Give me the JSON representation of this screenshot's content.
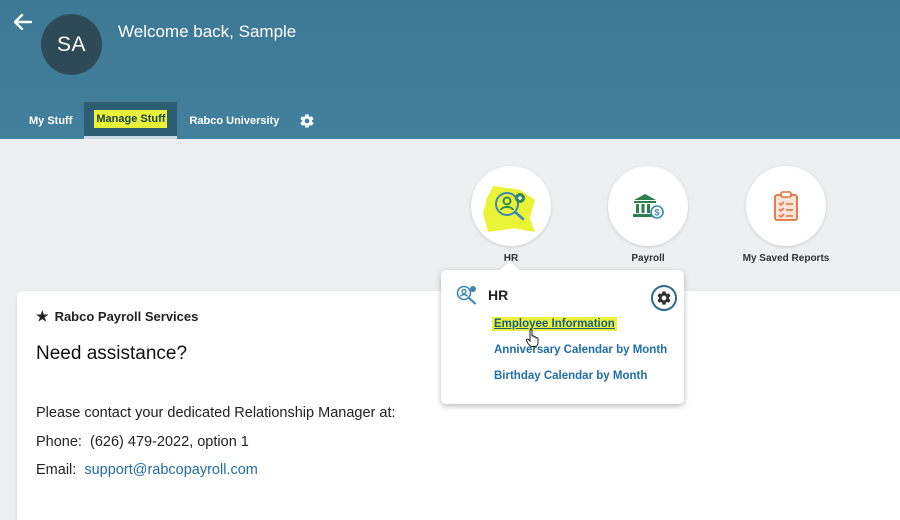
{
  "header": {
    "back_icon": "back-arrow-icon",
    "avatar_initials": "SA",
    "welcome_text": "Welcome back, Sample",
    "tabs": [
      {
        "label": "My Stuff"
      },
      {
        "label": "Manage Stuff",
        "active": true
      },
      {
        "label": "Rabco University"
      }
    ],
    "settings_icon": "gear-icon",
    "bg_color": "#3f7c98",
    "highlight_color": "#e8f43a"
  },
  "apps": [
    {
      "label": "HR",
      "icon": "hr-person-search-icon"
    },
    {
      "label": "Payroll",
      "icon": "bank-dollar-icon"
    },
    {
      "label": "My Saved Reports",
      "icon": "clipboard-checklist-icon"
    }
  ],
  "popup": {
    "title": "HR",
    "icon": "hr-person-search-icon",
    "settings_icon": "gear-icon",
    "links": [
      {
        "label": "Employee Information",
        "highlighted": true
      },
      {
        "label": "Anniversary Calendar by Month"
      },
      {
        "label": "Birthday Calendar by Month"
      }
    ]
  },
  "card": {
    "company": "Rabco Payroll Services",
    "title": "Need assistance?",
    "contact_line": "Please contact your dedicated Relationship Manager at:",
    "phone_label": "Phone:",
    "phone_value": "(626) 479-2022, option 1",
    "email_label": "Email:",
    "email_value": "support@rabcopayroll.com"
  }
}
